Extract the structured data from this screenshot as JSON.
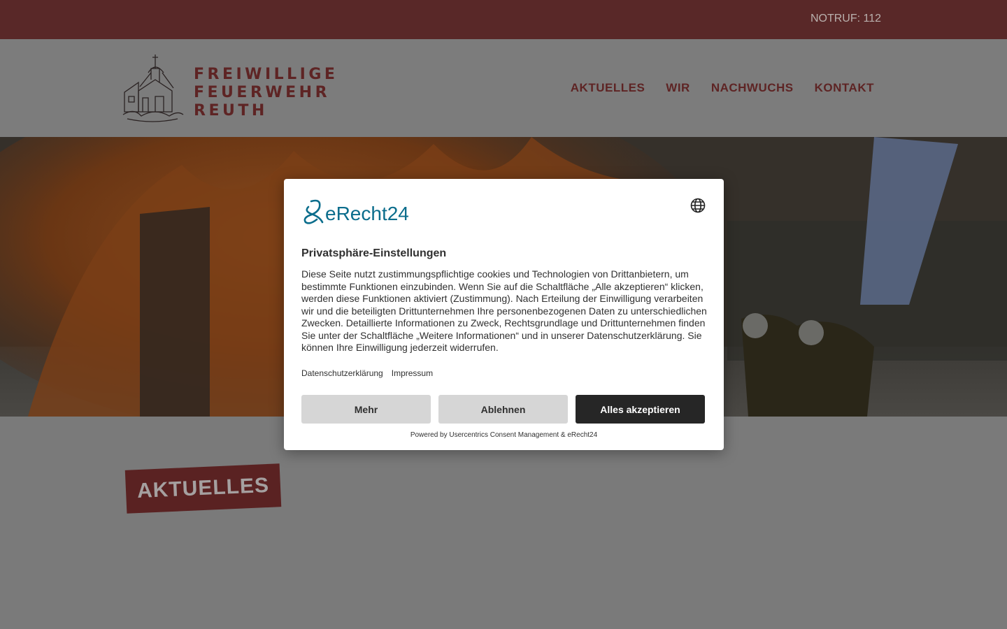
{
  "topbar": {
    "emergency": "NOTRUF: 112"
  },
  "logo": {
    "line1": "FREIWILLIGE",
    "line2": "FEUERWEHR",
    "line3": "REUTH"
  },
  "nav": {
    "items": [
      {
        "label": "AKTUELLES"
      },
      {
        "label": "WIR"
      },
      {
        "label": "NACHWUCHS"
      },
      {
        "label": "KONTAKT"
      }
    ]
  },
  "section": {
    "title": "AKTUELLES"
  },
  "consent": {
    "brand": "eRecht24",
    "title": "Privatsphäre-Einstellungen",
    "description": "Diese Seite nutzt zustimmungspflichtige cookies und Technologien von Drittanbietern, um bestimmte Funktionen einzubinden. Wenn Sie auf die Schaltfläche „Alle akzeptieren“ klicken, werden diese Funktionen aktiviert (Zustimmung). Nach Erteilung der Einwilligung verarbeiten wir und die beteiligten Drittunternehmen Ihre personenbezogenen Daten zu unterschiedlichen Zwecken. Detaillierte Informationen zu Zweck, Rechtsgrundlage und Drittunternehmen finden Sie unter der Schaltfläche „Weitere Informationen“ und in unserer Datenschutzerklärung. Sie können Ihre Einwilligung jederzeit widerrufen.",
    "link_privacy": "Datenschutzerklärung",
    "link_imprint": "Impressum",
    "btn_more": "Mehr",
    "btn_deny": "Ablehnen",
    "btn_accept": "Alles akzeptieren",
    "powered_by": "Powered by Usercentrics Consent Management & eRecht24"
  },
  "colors": {
    "topbar": "#592828",
    "brand_red": "#5e2424",
    "accept_button": "#262626",
    "erecht_blue": "#0b6d8c"
  }
}
